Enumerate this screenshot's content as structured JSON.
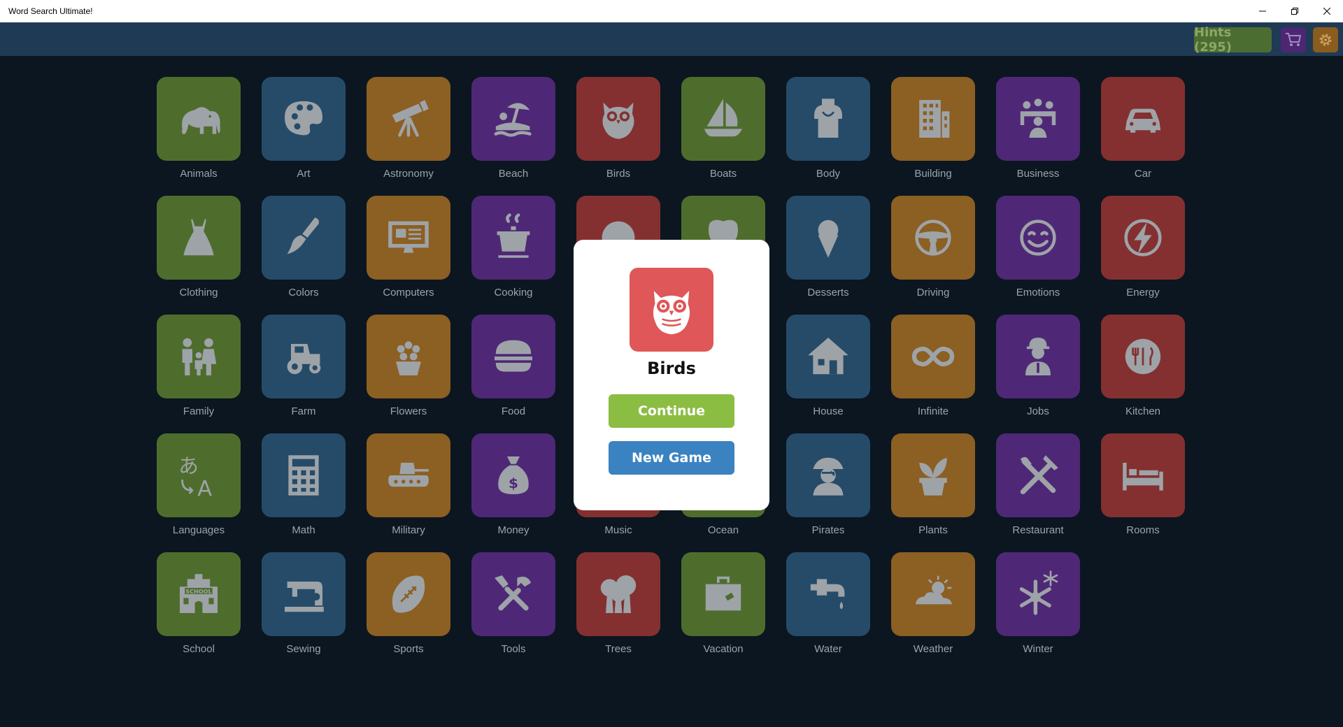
{
  "window": {
    "title": "Word Search Ultimate!",
    "controls": [
      "minimize",
      "restore",
      "close"
    ]
  },
  "toolbar": {
    "hints_label": "Hints (295)",
    "cart_icon": "cart-icon",
    "settings_icon": "gear-icon"
  },
  "colors": {
    "green": "#4e6d2d",
    "blue": "#254b69",
    "orange": "#8c5f22",
    "purple": "#4e2876",
    "red": "#843030",
    "continue": "#8bbd42",
    "new_game": "#3b82c1",
    "modal_icon": "#df5758"
  },
  "categories": [
    {
      "label": "Animals",
      "icon": "elephant-icon",
      "color": "green"
    },
    {
      "label": "Art",
      "icon": "palette-icon",
      "color": "blue"
    },
    {
      "label": "Astronomy",
      "icon": "telescope-icon",
      "color": "orange"
    },
    {
      "label": "Beach",
      "icon": "beach-umbrella-icon",
      "color": "purple"
    },
    {
      "label": "Birds",
      "icon": "owl-icon",
      "color": "red"
    },
    {
      "label": "Boats",
      "icon": "sailboat-icon",
      "color": "green"
    },
    {
      "label": "Body",
      "icon": "torso-icon",
      "color": "blue"
    },
    {
      "label": "Building",
      "icon": "building-icon",
      "color": "orange"
    },
    {
      "label": "Business",
      "icon": "meeting-icon",
      "color": "purple"
    },
    {
      "label": "Car",
      "icon": "car-icon",
      "color": "red"
    },
    {
      "label": "Clothing",
      "icon": "dress-icon",
      "color": "green"
    },
    {
      "label": "Colors",
      "icon": "paintbrush-icon",
      "color": "blue"
    },
    {
      "label": "Computers",
      "icon": "monitor-icon",
      "color": "orange"
    },
    {
      "label": "Cooking",
      "icon": "pot-icon",
      "color": "purple"
    },
    {
      "label": "",
      "icon": "globe-icon",
      "color": "red"
    },
    {
      "label": "",
      "icon": "tooth-icon",
      "color": "green"
    },
    {
      "label": "Desserts",
      "icon": "ice-cream-icon",
      "color": "blue"
    },
    {
      "label": "Driving",
      "icon": "steering-wheel-icon",
      "color": "orange"
    },
    {
      "label": "Emotions",
      "icon": "smiley-icon",
      "color": "purple"
    },
    {
      "label": "Energy",
      "icon": "lightning-icon",
      "color": "red"
    },
    {
      "label": "Family",
      "icon": "family-icon",
      "color": "green"
    },
    {
      "label": "Farm",
      "icon": "tractor-icon",
      "color": "blue"
    },
    {
      "label": "Flowers",
      "icon": "flower-pot-icon",
      "color": "orange"
    },
    {
      "label": "Food",
      "icon": "burger-icon",
      "color": "purple"
    },
    {
      "label": "",
      "icon": "",
      "color": "red"
    },
    {
      "label": "",
      "icon": "",
      "color": "green"
    },
    {
      "label": "House",
      "icon": "house-icon",
      "color": "blue"
    },
    {
      "label": "Infinite",
      "icon": "infinity-icon",
      "color": "orange"
    },
    {
      "label": "Jobs",
      "icon": "worker-icon",
      "color": "purple"
    },
    {
      "label": "Kitchen",
      "icon": "plate-cutlery-icon",
      "color": "red"
    },
    {
      "label": "Languages",
      "icon": "translate-icon",
      "color": "green"
    },
    {
      "label": "Math",
      "icon": "calculator-icon",
      "color": "blue"
    },
    {
      "label": "Military",
      "icon": "tank-icon",
      "color": "orange"
    },
    {
      "label": "Money",
      "icon": "money-bag-icon",
      "color": "purple"
    },
    {
      "label": "Music",
      "icon": "music-icon",
      "color": "red"
    },
    {
      "label": "Ocean",
      "icon": "wave-icon",
      "color": "green"
    },
    {
      "label": "Pirates",
      "icon": "pirate-icon",
      "color": "blue"
    },
    {
      "label": "Plants",
      "icon": "plant-icon",
      "color": "orange"
    },
    {
      "label": "Restaurant",
      "icon": "fork-knife-icon",
      "color": "purple"
    },
    {
      "label": "Rooms",
      "icon": "bed-icon",
      "color": "red"
    },
    {
      "label": "School",
      "icon": "school-icon",
      "color": "green"
    },
    {
      "label": "Sewing",
      "icon": "sewing-machine-icon",
      "color": "blue"
    },
    {
      "label": "Sports",
      "icon": "football-icon",
      "color": "orange"
    },
    {
      "label": "Tools",
      "icon": "tools-icon",
      "color": "purple"
    },
    {
      "label": "Trees",
      "icon": "trees-icon",
      "color": "red"
    },
    {
      "label": "Vacation",
      "icon": "suitcase-icon",
      "color": "green"
    },
    {
      "label": "Water",
      "icon": "faucet-icon",
      "color": "blue"
    },
    {
      "label": "Weather",
      "icon": "sun-cloud-icon",
      "color": "orange"
    },
    {
      "label": "Winter",
      "icon": "snowflake-icon",
      "color": "purple"
    }
  ],
  "dialog": {
    "title": "Birds",
    "icon": "owl-icon",
    "continue_label": "Continue",
    "new_game_label": "New Game"
  }
}
